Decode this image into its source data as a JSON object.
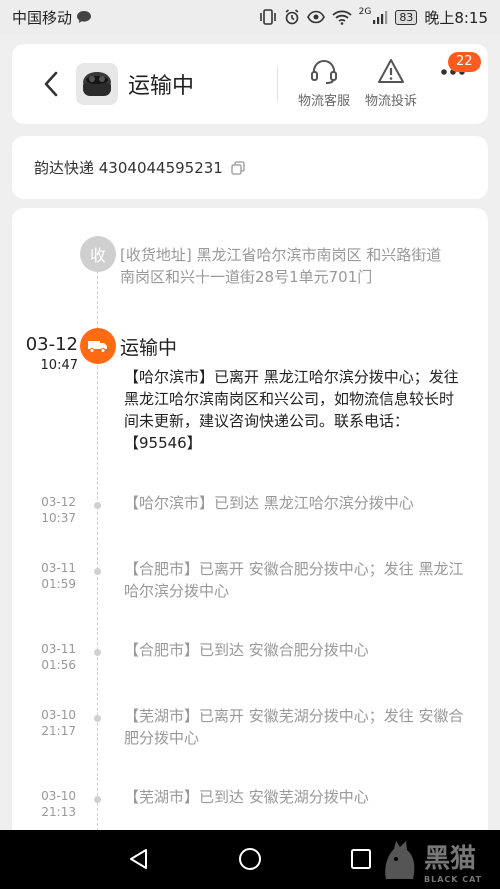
{
  "status_bar": {
    "carrier": "中国移动",
    "network": "2G",
    "battery": "83",
    "time": "晚上8:15"
  },
  "header": {
    "title": "运输中",
    "customer_service_label": "物流客服",
    "complaint_label": "物流投诉",
    "more_badge": "22"
  },
  "tracking": {
    "text": "韵达快递 4304044595231"
  },
  "receiver": {
    "badge": "收",
    "address": "[收货地址] 黑龙江省哈尔滨市南岗区 和兴路街道　南岗区和兴十一道街28号1单元701门"
  },
  "current": {
    "date": "03-12",
    "time": "10:47",
    "status": "运输中",
    "description": "【哈尔滨市】已离开 黑龙江哈尔滨分拨中心；发往 黑龙江哈尔滨南岗区和兴公司，如物流信息较长时间未更新，建议咨询快递公司。联系电话：【95546】"
  },
  "events": [
    {
      "date": "03-12",
      "time": "10:37",
      "text": "【哈尔滨市】已到达 黑龙江哈尔滨分拨中心"
    },
    {
      "date": "03-11",
      "time": "01:59",
      "text": "【合肥市】已离开 安徽合肥分拨中心；发往 黑龙江哈尔滨分拨中心"
    },
    {
      "date": "03-11",
      "time": "01:56",
      "text": "【合肥市】已到达 安徽合肥分拨中心"
    },
    {
      "date": "03-10",
      "time": "21:17",
      "text": "【芜湖市】已离开 安徽芜湖分拨中心；发往 安徽合肥分拨中心"
    },
    {
      "date": "03-10",
      "time": "21:13",
      "text": "【芜湖市】已到达 安徽芜湖分拨中心"
    }
  ],
  "watermark": {
    "main": "黑猫",
    "sub": "BLACK CAT"
  },
  "colors": {
    "accent": "#ff6a14",
    "badge": "#ff5a1f",
    "muted_text": "#999999"
  }
}
